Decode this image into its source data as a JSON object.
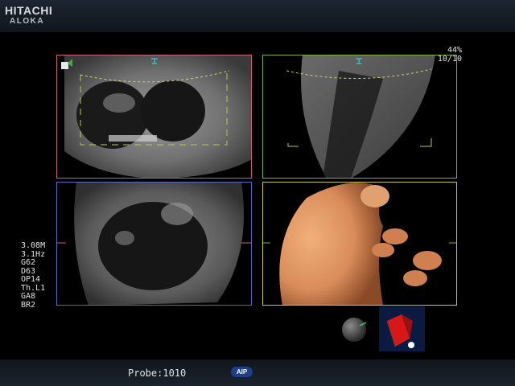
{
  "brand": {
    "line1": "HITACHI",
    "line2": "ALOKA"
  },
  "status": {
    "probe_text": "Probe:1010",
    "aip_label": "AIP"
  },
  "params": [
    "3.08M",
    "3.1Hz",
    "G62",
    "D63",
    "OP14",
    "Th.L1",
    "GA8",
    "BR2"
  ],
  "view_readout": {
    "percent": "44%",
    "frames": "10/10"
  },
  "colors": {
    "pane_top_left_border": "#c8607a",
    "pane_top_right_border": "#7fae3a",
    "pane_bottom_left_border": "#5a6ac0",
    "pane_bottom_right_border": "#c8c83a",
    "roi_box": "#a8d040",
    "render_skin": "#d98c5a",
    "cube_face": "#d81818"
  },
  "icons": [
    "camera-icon",
    "sphere-orientation-icon",
    "cube-orientation-icon",
    "marker-icon"
  ]
}
